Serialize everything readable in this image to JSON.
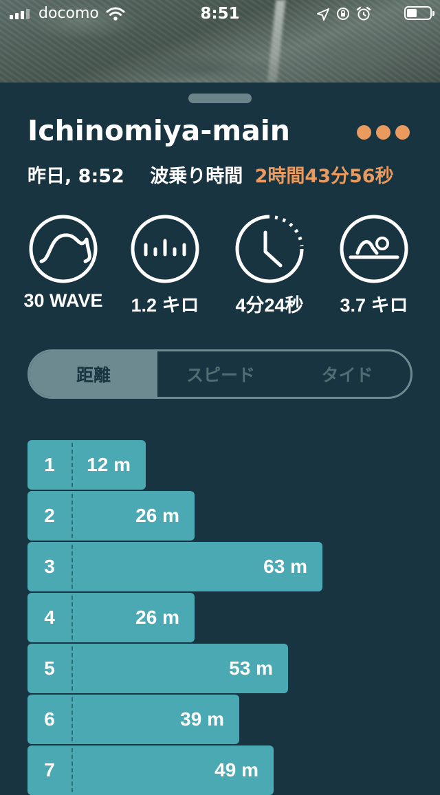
{
  "status_bar": {
    "carrier": "docomo",
    "time": "8:51"
  },
  "session": {
    "title": "Ichinomiya-main",
    "date": "昨日, 8:52",
    "duration_label": "波乗り時間",
    "duration_value": "2時間43分56秒"
  },
  "stats": [
    {
      "icon": "wave-icon",
      "value": "30 WAVE"
    },
    {
      "icon": "bars-icon",
      "value": "1.2 キロ"
    },
    {
      "icon": "clock-icon",
      "value": "4分24秒"
    },
    {
      "icon": "swim-icon",
      "value": "3.7 キロ"
    }
  ],
  "tabs": [
    {
      "label": "距離",
      "active": true
    },
    {
      "label": "スピード",
      "active": false
    },
    {
      "label": "タイド",
      "active": false
    }
  ],
  "colors": {
    "background": "#183440",
    "accent": "#eb9a5e",
    "bar": "#4aa9b3"
  },
  "waves": [
    {
      "index": "1",
      "distance": 12,
      "label": "12 m"
    },
    {
      "index": "2",
      "distance": 26,
      "label": "26 m"
    },
    {
      "index": "3",
      "distance": 63,
      "label": "63 m"
    },
    {
      "index": "4",
      "distance": 26,
      "label": "26 m"
    },
    {
      "index": "5",
      "distance": 53,
      "label": "53 m"
    },
    {
      "index": "6",
      "distance": 39,
      "label": "39 m"
    },
    {
      "index": "7",
      "distance": 49,
      "label": "49 m"
    }
  ]
}
